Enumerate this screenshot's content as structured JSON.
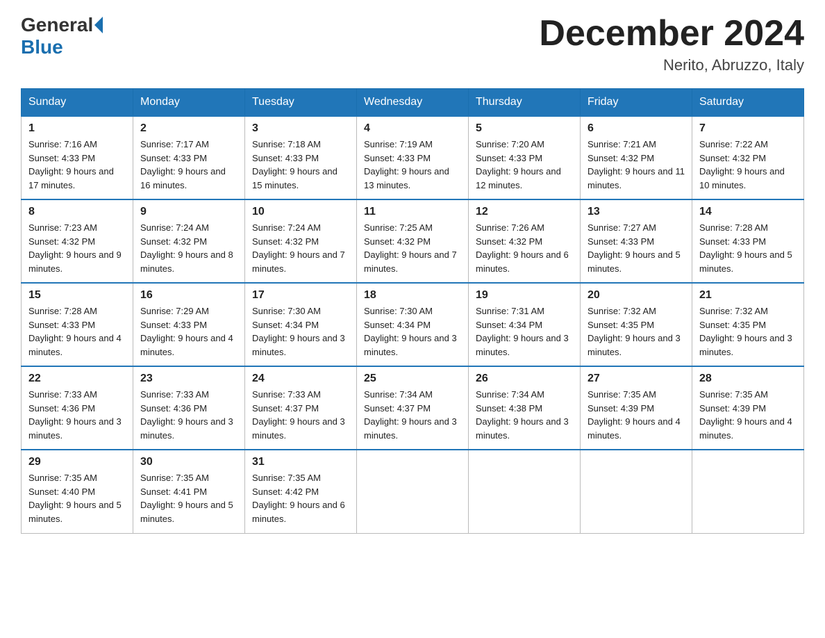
{
  "header": {
    "logo_general": "General",
    "logo_blue": "Blue",
    "month_title": "December 2024",
    "location": "Nerito, Abruzzo, Italy"
  },
  "days_of_week": [
    "Sunday",
    "Monday",
    "Tuesday",
    "Wednesday",
    "Thursday",
    "Friday",
    "Saturday"
  ],
  "weeks": [
    [
      {
        "day": "1",
        "sunrise": "Sunrise: 7:16 AM",
        "sunset": "Sunset: 4:33 PM",
        "daylight": "Daylight: 9 hours and 17 minutes."
      },
      {
        "day": "2",
        "sunrise": "Sunrise: 7:17 AM",
        "sunset": "Sunset: 4:33 PM",
        "daylight": "Daylight: 9 hours and 16 minutes."
      },
      {
        "day": "3",
        "sunrise": "Sunrise: 7:18 AM",
        "sunset": "Sunset: 4:33 PM",
        "daylight": "Daylight: 9 hours and 15 minutes."
      },
      {
        "day": "4",
        "sunrise": "Sunrise: 7:19 AM",
        "sunset": "Sunset: 4:33 PM",
        "daylight": "Daylight: 9 hours and 13 minutes."
      },
      {
        "day": "5",
        "sunrise": "Sunrise: 7:20 AM",
        "sunset": "Sunset: 4:33 PM",
        "daylight": "Daylight: 9 hours and 12 minutes."
      },
      {
        "day": "6",
        "sunrise": "Sunrise: 7:21 AM",
        "sunset": "Sunset: 4:32 PM",
        "daylight": "Daylight: 9 hours and 11 minutes."
      },
      {
        "day": "7",
        "sunrise": "Sunrise: 7:22 AM",
        "sunset": "Sunset: 4:32 PM",
        "daylight": "Daylight: 9 hours and 10 minutes."
      }
    ],
    [
      {
        "day": "8",
        "sunrise": "Sunrise: 7:23 AM",
        "sunset": "Sunset: 4:32 PM",
        "daylight": "Daylight: 9 hours and 9 minutes."
      },
      {
        "day": "9",
        "sunrise": "Sunrise: 7:24 AM",
        "sunset": "Sunset: 4:32 PM",
        "daylight": "Daylight: 9 hours and 8 minutes."
      },
      {
        "day": "10",
        "sunrise": "Sunrise: 7:24 AM",
        "sunset": "Sunset: 4:32 PM",
        "daylight": "Daylight: 9 hours and 7 minutes."
      },
      {
        "day": "11",
        "sunrise": "Sunrise: 7:25 AM",
        "sunset": "Sunset: 4:32 PM",
        "daylight": "Daylight: 9 hours and 7 minutes."
      },
      {
        "day": "12",
        "sunrise": "Sunrise: 7:26 AM",
        "sunset": "Sunset: 4:32 PM",
        "daylight": "Daylight: 9 hours and 6 minutes."
      },
      {
        "day": "13",
        "sunrise": "Sunrise: 7:27 AM",
        "sunset": "Sunset: 4:33 PM",
        "daylight": "Daylight: 9 hours and 5 minutes."
      },
      {
        "day": "14",
        "sunrise": "Sunrise: 7:28 AM",
        "sunset": "Sunset: 4:33 PM",
        "daylight": "Daylight: 9 hours and 5 minutes."
      }
    ],
    [
      {
        "day": "15",
        "sunrise": "Sunrise: 7:28 AM",
        "sunset": "Sunset: 4:33 PM",
        "daylight": "Daylight: 9 hours and 4 minutes."
      },
      {
        "day": "16",
        "sunrise": "Sunrise: 7:29 AM",
        "sunset": "Sunset: 4:33 PM",
        "daylight": "Daylight: 9 hours and 4 minutes."
      },
      {
        "day": "17",
        "sunrise": "Sunrise: 7:30 AM",
        "sunset": "Sunset: 4:34 PM",
        "daylight": "Daylight: 9 hours and 3 minutes."
      },
      {
        "day": "18",
        "sunrise": "Sunrise: 7:30 AM",
        "sunset": "Sunset: 4:34 PM",
        "daylight": "Daylight: 9 hours and 3 minutes."
      },
      {
        "day": "19",
        "sunrise": "Sunrise: 7:31 AM",
        "sunset": "Sunset: 4:34 PM",
        "daylight": "Daylight: 9 hours and 3 minutes."
      },
      {
        "day": "20",
        "sunrise": "Sunrise: 7:32 AM",
        "sunset": "Sunset: 4:35 PM",
        "daylight": "Daylight: 9 hours and 3 minutes."
      },
      {
        "day": "21",
        "sunrise": "Sunrise: 7:32 AM",
        "sunset": "Sunset: 4:35 PM",
        "daylight": "Daylight: 9 hours and 3 minutes."
      }
    ],
    [
      {
        "day": "22",
        "sunrise": "Sunrise: 7:33 AM",
        "sunset": "Sunset: 4:36 PM",
        "daylight": "Daylight: 9 hours and 3 minutes."
      },
      {
        "day": "23",
        "sunrise": "Sunrise: 7:33 AM",
        "sunset": "Sunset: 4:36 PM",
        "daylight": "Daylight: 9 hours and 3 minutes."
      },
      {
        "day": "24",
        "sunrise": "Sunrise: 7:33 AM",
        "sunset": "Sunset: 4:37 PM",
        "daylight": "Daylight: 9 hours and 3 minutes."
      },
      {
        "day": "25",
        "sunrise": "Sunrise: 7:34 AM",
        "sunset": "Sunset: 4:37 PM",
        "daylight": "Daylight: 9 hours and 3 minutes."
      },
      {
        "day": "26",
        "sunrise": "Sunrise: 7:34 AM",
        "sunset": "Sunset: 4:38 PM",
        "daylight": "Daylight: 9 hours and 3 minutes."
      },
      {
        "day": "27",
        "sunrise": "Sunrise: 7:35 AM",
        "sunset": "Sunset: 4:39 PM",
        "daylight": "Daylight: 9 hours and 4 minutes."
      },
      {
        "day": "28",
        "sunrise": "Sunrise: 7:35 AM",
        "sunset": "Sunset: 4:39 PM",
        "daylight": "Daylight: 9 hours and 4 minutes."
      }
    ],
    [
      {
        "day": "29",
        "sunrise": "Sunrise: 7:35 AM",
        "sunset": "Sunset: 4:40 PM",
        "daylight": "Daylight: 9 hours and 5 minutes."
      },
      {
        "day": "30",
        "sunrise": "Sunrise: 7:35 AM",
        "sunset": "Sunset: 4:41 PM",
        "daylight": "Daylight: 9 hours and 5 minutes."
      },
      {
        "day": "31",
        "sunrise": "Sunrise: 7:35 AM",
        "sunset": "Sunset: 4:42 PM",
        "daylight": "Daylight: 9 hours and 6 minutes."
      },
      null,
      null,
      null,
      null
    ]
  ]
}
